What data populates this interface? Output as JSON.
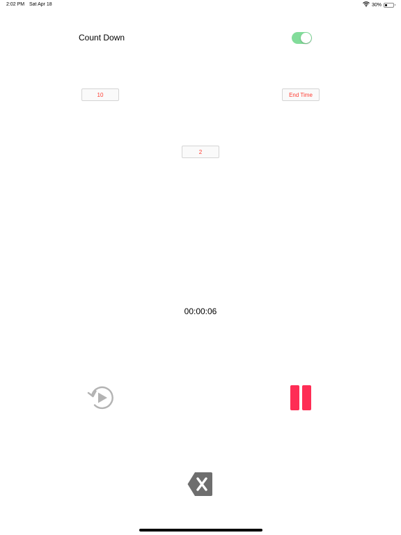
{
  "status_bar": {
    "time": "2:02 PM",
    "date": "Sat Apr 18",
    "battery_percent": "30%",
    "battery_level": 0.3,
    "icons": [
      "wifi-icon",
      "battery-icon"
    ]
  },
  "settings": {
    "count_down_label": "Count Down",
    "count_down_enabled": true,
    "start_value": "10",
    "end_time_label": "End Time",
    "interval_value": "2"
  },
  "timer": {
    "display": "00:00:06"
  },
  "controls": {
    "restart_icon": "restart-play-icon",
    "pause_icon": "pause-icon",
    "delete_icon": "backspace-icon"
  },
  "colors": {
    "accent_red": "#fe2d55",
    "field_text": "#ff3b30",
    "toggle_on": "#82dc9a",
    "icon_gray": "#b3b3b3",
    "delete_gray": "#6e6e6e"
  }
}
